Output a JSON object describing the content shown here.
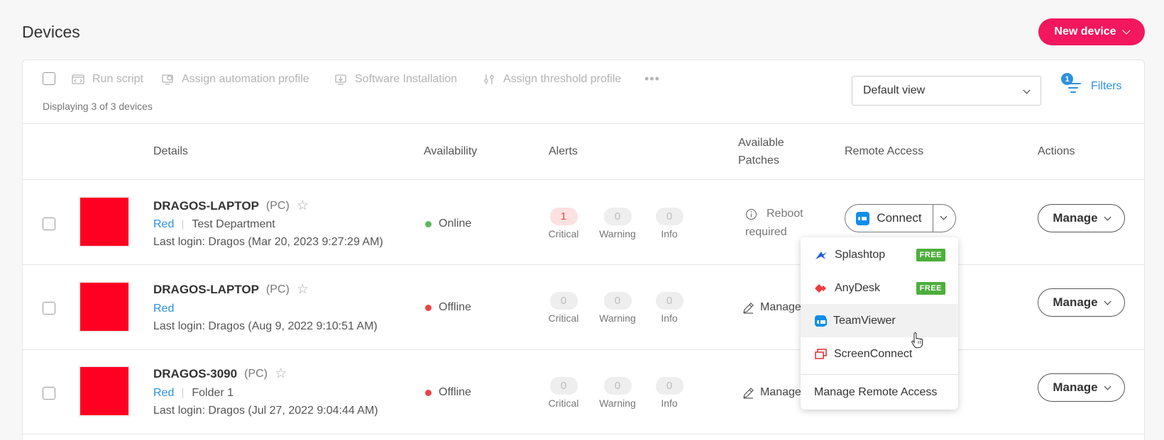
{
  "page": {
    "title": "Devices",
    "new_device_label": "New device"
  },
  "toolbar": {
    "actions": [
      "Run script",
      "Assign automation profile",
      "Software Installation",
      "Assign threshold profile"
    ],
    "more": "•••",
    "displaying": "Displaying 3 of 3 devices",
    "view_select": "Default view",
    "filters_label": "Filters",
    "filters_count": "1"
  },
  "columns": {
    "details": "Details",
    "availability": "Availability",
    "alerts": "Alerts",
    "patches_1": "Available",
    "patches_2": "Patches",
    "remote": "Remote Access",
    "actions": "Actions"
  },
  "alert_labels": {
    "critical": "Critical",
    "warning": "Warning",
    "info": "Info"
  },
  "rows": [
    {
      "name": "DRAGOS-LAPTOP",
      "type": "(PC)",
      "tag": "Red",
      "folder": "Test Department",
      "login": "Last login: Dragos (Mar 20, 2023 9:27:29 AM)",
      "status": "Online",
      "status_color": "#5cb85c",
      "critical": "1",
      "warning": "0",
      "info": "0",
      "patch_1": "Reboot",
      "patch_2": "required",
      "connect": "Connect",
      "manage": "Manage"
    },
    {
      "name": "DRAGOS-LAPTOP",
      "type": "(PC)",
      "tag": "Red",
      "folder": "",
      "login": "Last login: Dragos (Aug 9, 2022 9:10:51 AM)",
      "status": "Offline",
      "status_color": "#e84545",
      "critical": "0",
      "warning": "0",
      "info": "0",
      "patch_manage": "Manage",
      "manage": "Manage"
    },
    {
      "name": "DRAGOS-3090",
      "type": "(PC)",
      "tag": "Red",
      "folder": "Folder 1",
      "login": "Last login: Dragos (Jul 27, 2022 9:04:44 AM)",
      "status": "Offline",
      "status_color": "#e84545",
      "critical": "0",
      "warning": "0",
      "info": "0",
      "patch_manage": "Manage",
      "manage": "Manage"
    }
  ],
  "remote_menu": {
    "items": [
      {
        "label": "Splashtop",
        "badge": "FREE"
      },
      {
        "label": "AnyDesk",
        "badge": "FREE"
      },
      {
        "label": "TeamViewer"
      },
      {
        "label": "ScreenConnect"
      }
    ],
    "footer": "Manage Remote Access"
  },
  "colors": {
    "accent": "#f2175f",
    "link": "#2c91e0",
    "free_badge": "#4cae3c"
  }
}
